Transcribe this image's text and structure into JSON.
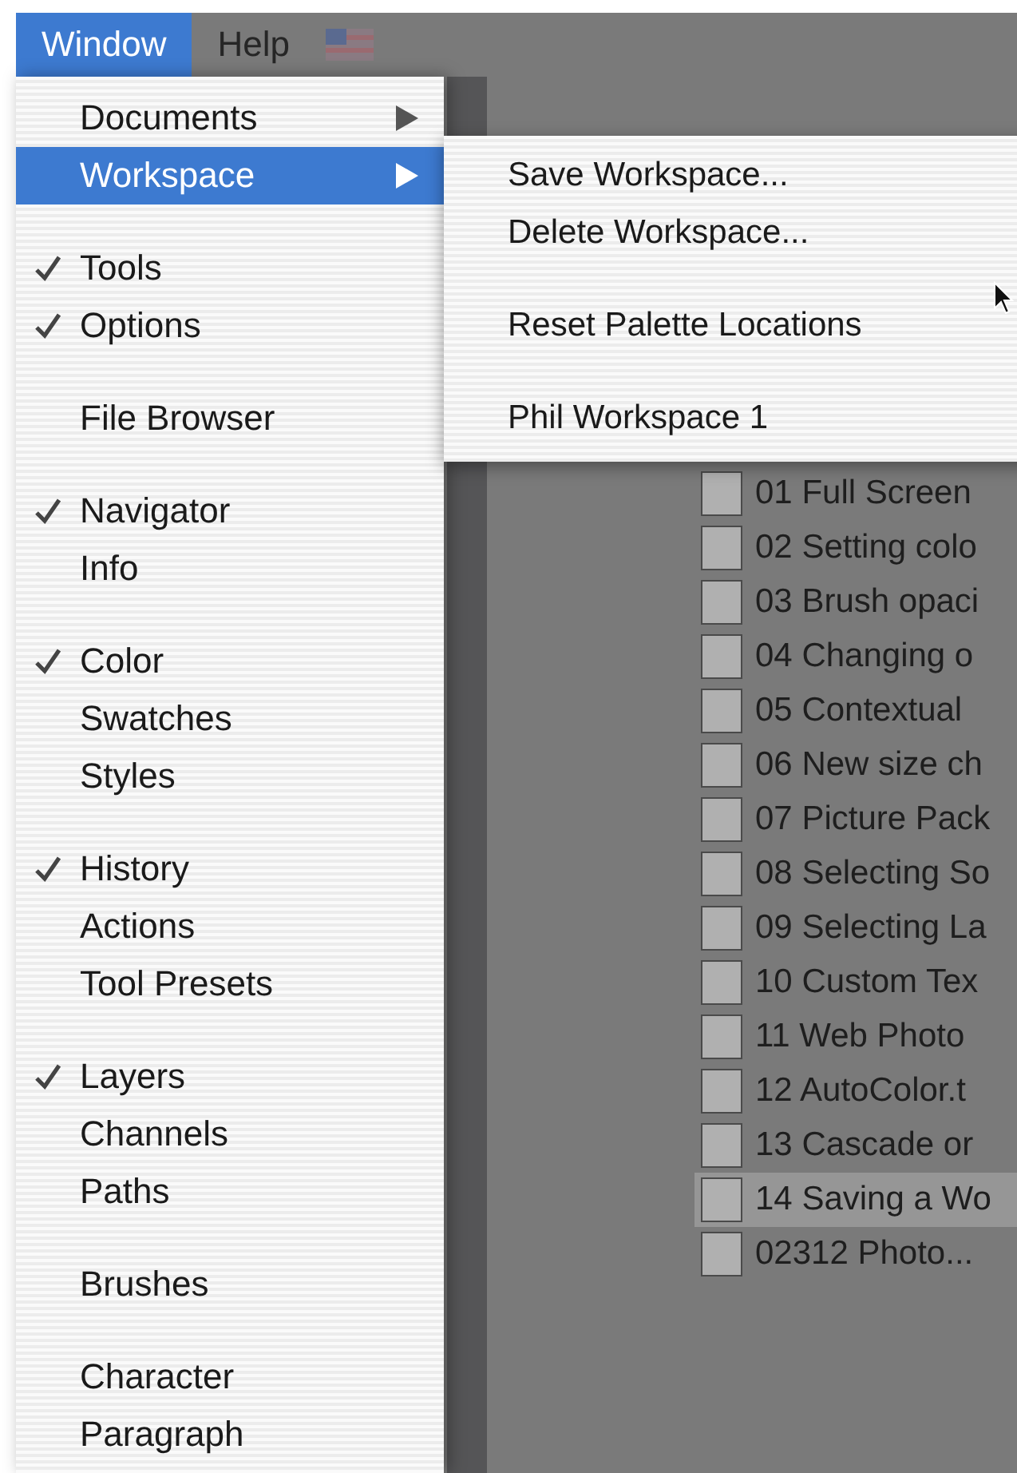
{
  "menu_bar": [
    {
      "label": "Window",
      "selected": true
    },
    {
      "label": "Help",
      "selected": false
    }
  ],
  "window_menu": {
    "items": [
      {
        "kind": "item",
        "label": "Documents",
        "checked": false,
        "submenu": true,
        "selected": false
      },
      {
        "kind": "item",
        "label": "Workspace",
        "checked": false,
        "submenu": true,
        "selected": true
      },
      {
        "kind": "separator"
      },
      {
        "kind": "item",
        "label": "Tools",
        "checked": true,
        "submenu": false,
        "selected": false
      },
      {
        "kind": "item",
        "label": "Options",
        "checked": true,
        "submenu": false,
        "selected": false
      },
      {
        "kind": "separator"
      },
      {
        "kind": "item",
        "label": "File Browser",
        "checked": false,
        "submenu": false,
        "selected": false
      },
      {
        "kind": "separator"
      },
      {
        "kind": "item",
        "label": "Navigator",
        "checked": true,
        "submenu": false,
        "selected": false
      },
      {
        "kind": "item",
        "label": "Info",
        "checked": false,
        "submenu": false,
        "selected": false
      },
      {
        "kind": "separator"
      },
      {
        "kind": "item",
        "label": "Color",
        "checked": true,
        "submenu": false,
        "selected": false
      },
      {
        "kind": "item",
        "label": "Swatches",
        "checked": false,
        "submenu": false,
        "selected": false
      },
      {
        "kind": "item",
        "label": "Styles",
        "checked": false,
        "submenu": false,
        "selected": false
      },
      {
        "kind": "separator"
      },
      {
        "kind": "item",
        "label": "History",
        "checked": true,
        "submenu": false,
        "selected": false
      },
      {
        "kind": "item",
        "label": "Actions",
        "checked": false,
        "submenu": false,
        "selected": false
      },
      {
        "kind": "item",
        "label": "Tool Presets",
        "checked": false,
        "submenu": false,
        "selected": false
      },
      {
        "kind": "separator"
      },
      {
        "kind": "item",
        "label": "Layers",
        "checked": true,
        "submenu": false,
        "selected": false
      },
      {
        "kind": "item",
        "label": "Channels",
        "checked": false,
        "submenu": false,
        "selected": false
      },
      {
        "kind": "item",
        "label": "Paths",
        "checked": false,
        "submenu": false,
        "selected": false
      },
      {
        "kind": "separator"
      },
      {
        "kind": "item",
        "label": "Brushes",
        "checked": false,
        "submenu": false,
        "selected": false
      },
      {
        "kind": "separator"
      },
      {
        "kind": "item",
        "label": "Character",
        "checked": false,
        "submenu": false,
        "selected": false
      },
      {
        "kind": "item",
        "label": "Paragraph",
        "checked": false,
        "submenu": false,
        "selected": false
      }
    ]
  },
  "workspace_submenu": {
    "items": [
      {
        "kind": "item",
        "label": "Save Workspace..."
      },
      {
        "kind": "item",
        "label": "Delete Workspace..."
      },
      {
        "kind": "separator"
      },
      {
        "kind": "item",
        "label": "Reset Palette Locations"
      },
      {
        "kind": "separator"
      },
      {
        "kind": "item",
        "label": "Phil Workspace 1"
      }
    ]
  },
  "file_list": {
    "items": [
      {
        "label": "01 Full Screen",
        "selected": false
      },
      {
        "label": "02 Setting colo",
        "selected": false
      },
      {
        "label": "03 Brush opaci",
        "selected": false
      },
      {
        "label": "04 Changing o",
        "selected": false
      },
      {
        "label": "05 Contextual",
        "selected": false
      },
      {
        "label": "06 New size ch",
        "selected": false
      },
      {
        "label": "07 Picture Pack",
        "selected": false
      },
      {
        "label": "08 Selecting So",
        "selected": false
      },
      {
        "label": "09 Selecting La",
        "selected": false
      },
      {
        "label": "10 Custom Tex",
        "selected": false
      },
      {
        "label": "11 Web Photo",
        "selected": false
      },
      {
        "label": "12 AutoColor.t",
        "selected": false
      },
      {
        "label": "13 Cascade or",
        "selected": false
      },
      {
        "label": "14 Saving a Wo",
        "selected": true
      },
      {
        "label": "02312 Photo...",
        "selected": false
      }
    ]
  }
}
